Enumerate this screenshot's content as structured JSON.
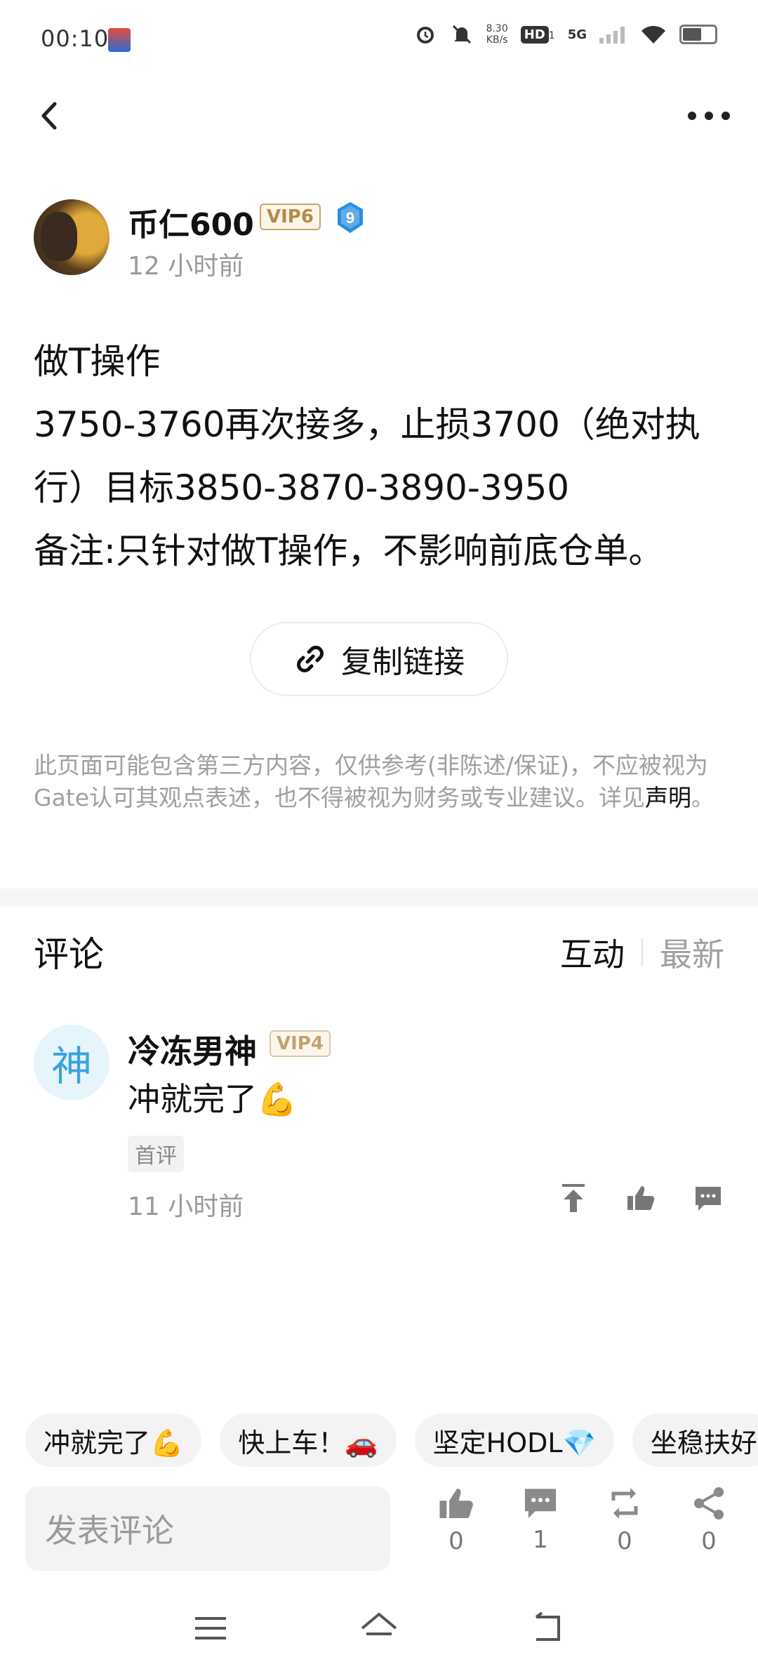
{
  "status_bar": {
    "time": "00:10",
    "net_speed_value": "8.30",
    "net_speed_unit": "KB/s",
    "hd_label": "HD",
    "hd_sub": "1",
    "network_label": "5G",
    "icons": [
      "alarm-icon",
      "mute-icon",
      "signal-icon",
      "wifi-icon",
      "battery-icon"
    ]
  },
  "topbar": {
    "back_icon": "chevron-left-icon",
    "more_icon": "more-dots-icon"
  },
  "post": {
    "author_name": "币仁600",
    "vip_label": "VIP6",
    "level": "9",
    "time": "12 小时前",
    "lines": [
      "做T操作",
      "3750-3760再次接多，止损3700（绝对执行）目标3850-3870-3890-3950",
      "备注:只针对做T操作，不影响前底仓单。"
    ],
    "copy_link_label": "复制链接",
    "disclaimer_text": "此页面可能包含第三方内容，仅供参考(非陈述/保证)，不应被视为Gate认可其观点表述，也不得被视为财务或专业建议。详见",
    "disclaimer_link": "声明",
    "disclaimer_end": "。"
  },
  "comments": {
    "title": "评论",
    "sort_tabs": [
      "互动",
      "最新"
    ],
    "items": [
      {
        "avatar_char": "神",
        "name": "冷冻男神",
        "vip_label": "VIP4",
        "text": "冲就完了💪",
        "tag": "首评",
        "time": "11 小时前"
      }
    ]
  },
  "quick_replies": [
    "冲就完了💪",
    "快上车！🚗",
    "坚定HODL💎",
    "坐稳扶好"
  ],
  "bottom_bar": {
    "input_placeholder": "发表评论",
    "stats": [
      {
        "icon": "like-icon",
        "count": "0"
      },
      {
        "icon": "comment-icon",
        "count": "1"
      },
      {
        "icon": "repost-icon",
        "count": "0"
      },
      {
        "icon": "share-icon",
        "count": "0"
      }
    ]
  },
  "colors": {
    "accent_blue": "#3ba3e0",
    "vip_gold": "#b58a4a",
    "muted_text": "#9a9a9a"
  }
}
